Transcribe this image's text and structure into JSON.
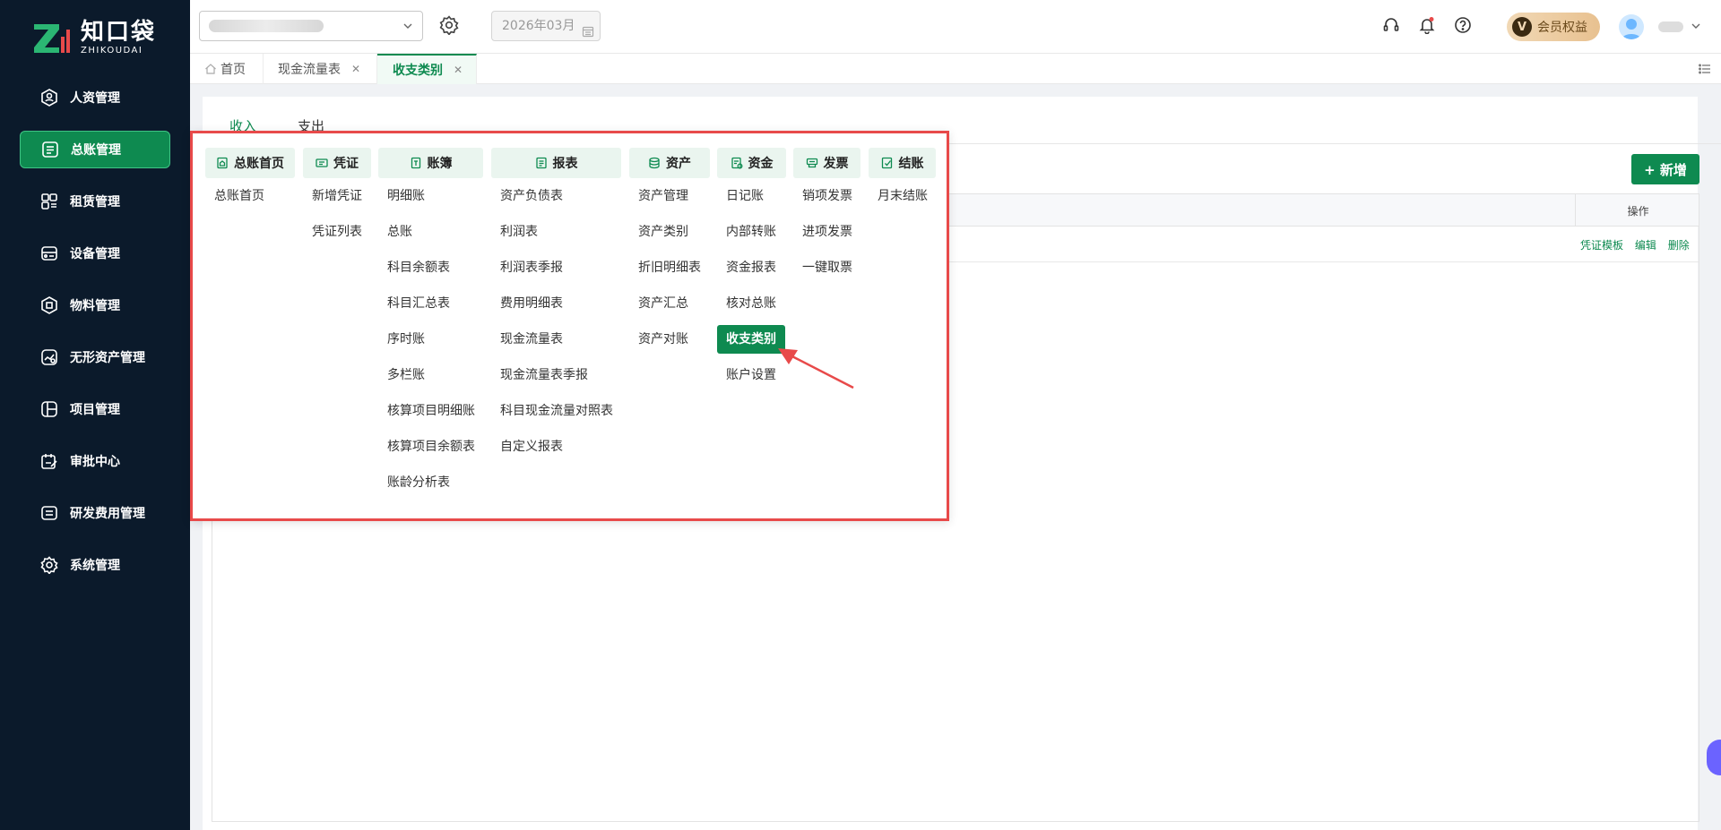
{
  "app": {
    "logo_cn": "知口袋",
    "logo_en": "ZHIKOUDAI"
  },
  "sidebar": {
    "items": [
      {
        "label": "人资管理",
        "icon": "person-badge-icon"
      },
      {
        "label": "总账管理",
        "icon": "ledger-icon"
      },
      {
        "label": "租赁管理",
        "icon": "lease-icon"
      },
      {
        "label": "设备管理",
        "icon": "device-icon"
      },
      {
        "label": "物料管理",
        "icon": "box-icon"
      },
      {
        "label": "无形资产管理",
        "icon": "intangible-asset-icon"
      },
      {
        "label": "项目管理",
        "icon": "project-icon"
      },
      {
        "label": "审批中心",
        "icon": "approval-icon"
      },
      {
        "label": "研发费用管理",
        "icon": "rd-cost-icon"
      },
      {
        "label": "系统管理",
        "icon": "gear-icon"
      }
    ],
    "active_index": 1
  },
  "topbar": {
    "date_value": "2026年03月",
    "vip_badge": "V",
    "vip_label": "会员权益"
  },
  "tabs": [
    {
      "label": "首页",
      "closable": false
    },
    {
      "label": "现金流量表",
      "closable": true
    },
    {
      "label": "收支类别",
      "closable": true,
      "active": true
    }
  ],
  "content": {
    "sub_tabs": [
      "收入",
      "支出"
    ],
    "add_label": "+ 新增",
    "op_header": "操作",
    "row_actions": [
      "凭证模板",
      "编辑",
      "删除"
    ]
  },
  "mega_menu": {
    "columns": [
      {
        "title": "总账首页",
        "icon": "home-doc-icon",
        "items": [
          "总账首页"
        ]
      },
      {
        "title": "凭证",
        "icon": "voucher-icon",
        "items": [
          "新增凭证",
          "凭证列表"
        ]
      },
      {
        "title": "账簿",
        "icon": "book-icon",
        "items": [
          "明细账",
          "总账",
          "科目余额表",
          "科目汇总表",
          "序时账",
          "多栏账",
          "核算项目明细账",
          "核算项目余额表",
          "账龄分析表"
        ]
      },
      {
        "title": "报表",
        "icon": "report-icon",
        "items": [
          "资产负债表",
          "利润表",
          "利润表季报",
          "费用明细表",
          "现金流量表",
          "现金流量表季报",
          "科目现金流量对照表",
          "自定义报表"
        ]
      },
      {
        "title": "资产",
        "icon": "asset-icon",
        "items": [
          "资产管理",
          "资产类别",
          "折旧明细表",
          "资产汇总",
          "资产对账"
        ]
      },
      {
        "title": "资金",
        "icon": "fund-icon",
        "items": [
          "日记账",
          "内部转账",
          "资金报表",
          "核对总账",
          "收支类别",
          "账户设置"
        ]
      },
      {
        "title": "发票",
        "icon": "invoice-icon",
        "items": [
          "销项发票",
          "进项发票",
          "一键取票"
        ]
      },
      {
        "title": "结账",
        "icon": "close-book-icon",
        "items": [
          "月末结账"
        ]
      }
    ],
    "highlighted_item": "收支类别",
    "colors": {
      "accent": "#0e8a50",
      "frame": "#e84a4a",
      "head_bg": "#eaf5ef"
    }
  }
}
